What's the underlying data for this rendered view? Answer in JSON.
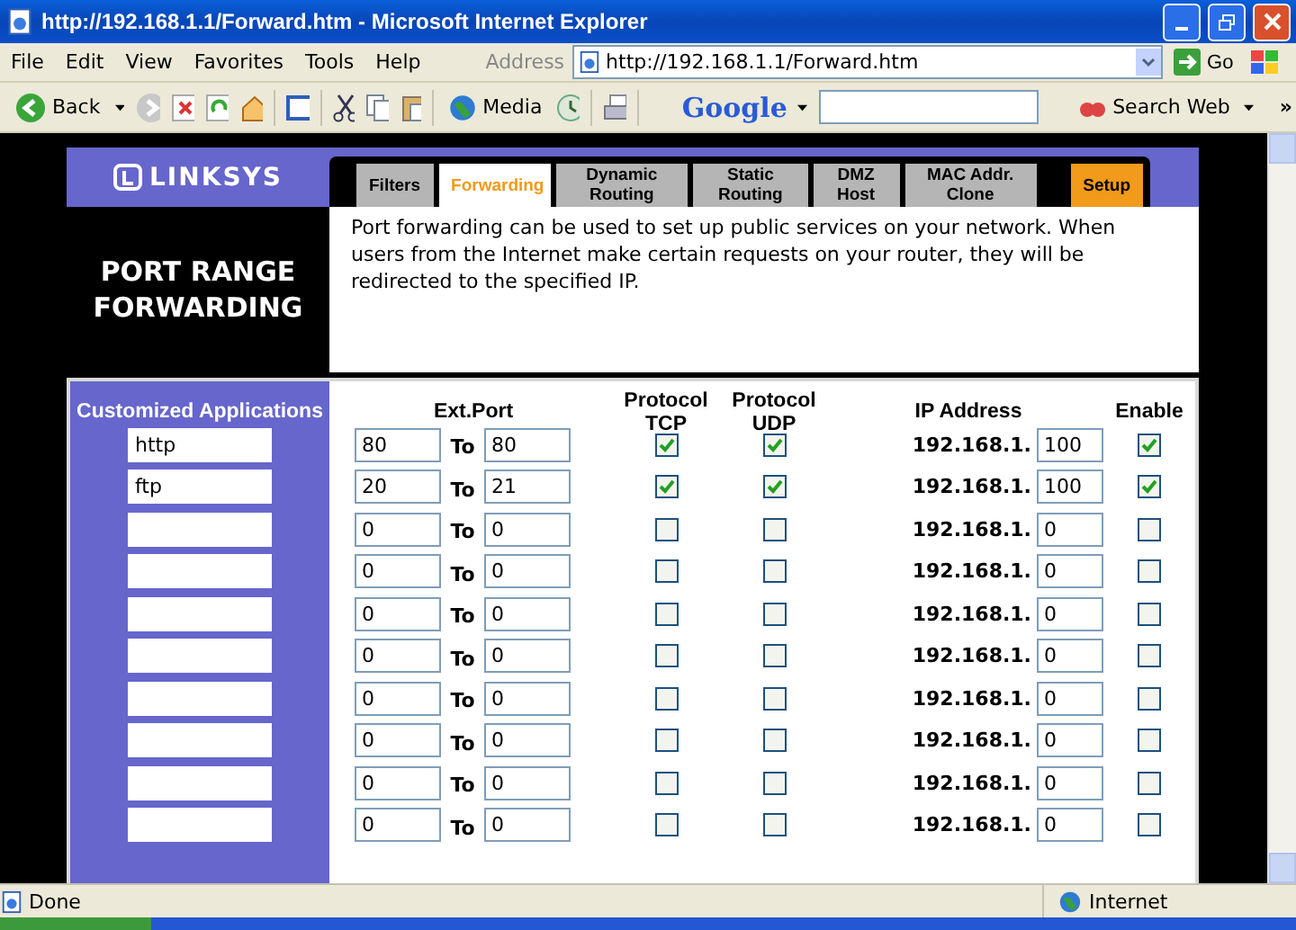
{
  "window": {
    "title": "http://192.168.1.1/Forward.htm - Microsoft Internet Explorer"
  },
  "menu": [
    "File",
    "Edit",
    "View",
    "Favorites",
    "Tools",
    "Help"
  ],
  "address": {
    "label": "Address",
    "value": "http://192.168.1.1/Forward.htm",
    "go": "Go"
  },
  "toolbar": {
    "back": "Back",
    "media": "Media",
    "google": "Google",
    "search": "Search Web",
    "more": "»"
  },
  "page": {
    "logo": "LINKSYS",
    "tabs": [
      {
        "label": "Filters",
        "kind": "gray",
        "selected": false
      },
      {
        "label": "Forwarding",
        "kind": "gray",
        "selected": true
      },
      {
        "label": "Dynamic Routing",
        "kind": "gray",
        "selected": false
      },
      {
        "label": "Static Routing",
        "kind": "gray",
        "selected": false
      },
      {
        "label": "DMZ Host",
        "kind": "gray",
        "selected": false
      },
      {
        "label": "MAC Addr. Clone",
        "kind": "gray",
        "selected": false
      },
      {
        "label": "Setup",
        "kind": "orange",
        "selected": false
      }
    ],
    "section_title": "PORT RANGE FORWARDING",
    "description": "Port forwarding can be used to set up public services on your network. When users from the Internet make certain requests on your router, they will be redirected to the specified IP.",
    "table": {
      "columns": [
        "Customized Applications",
        "Ext.Port",
        "Protocol TCP",
        "Protocol UDP",
        "IP Address",
        "Enable"
      ],
      "rows": [
        {
          "app": "http",
          "from": "80",
          "to_label": "To",
          "to": "80",
          "tcp": true,
          "udp": true,
          "ip_prefix": "192.168.1.",
          "ip": "100",
          "enable": true
        },
        {
          "app": "ftp",
          "from": "20",
          "to_label": "To",
          "to": "21",
          "tcp": true,
          "udp": true,
          "ip_prefix": "192.168.1.",
          "ip": "100",
          "enable": true
        },
        {
          "from": "0",
          "to_label": "To",
          "to": "0",
          "tcp": false,
          "udp": false,
          "ip_prefix": "192.168.1.",
          "ip": "0",
          "enable": false
        },
        {
          "from": "0",
          "to_label": "To",
          "to": "0",
          "tcp": false,
          "udp": false,
          "ip_prefix": "192.168.1.",
          "ip": "0",
          "enable": false
        },
        {
          "from": "0",
          "to_label": "To",
          "to": "0",
          "tcp": false,
          "udp": false,
          "ip_prefix": "192.168.1.",
          "ip": "0",
          "enable": false
        },
        {
          "from": "0",
          "to_label": "To",
          "to": "0",
          "tcp": false,
          "udp": false,
          "ip_prefix": "192.168.1.",
          "ip": "0",
          "enable": false
        },
        {
          "from": "0",
          "to_label": "To",
          "to": "0",
          "tcp": false,
          "udp": false,
          "ip_prefix": "192.168.1.",
          "ip": "0",
          "enable": false
        },
        {
          "from": "0",
          "to_label": "To",
          "to": "0",
          "tcp": false,
          "udp": false,
          "ip_prefix": "192.168.1.",
          "ip": "0",
          "enable": false
        },
        {
          "from": "0",
          "to_label": "To",
          "to": "0",
          "tcp": false,
          "udp": false,
          "ip_prefix": "192.168.1.",
          "ip": "0",
          "enable": false
        },
        {
          "from": "0",
          "to_label": "To",
          "to": "0",
          "tcp": false,
          "udp": false,
          "ip_prefix": "192.168.1.",
          "ip": "0",
          "enable": false
        }
      ]
    }
  },
  "status_bar": {
    "text": "Done",
    "zone": "Internet"
  }
}
